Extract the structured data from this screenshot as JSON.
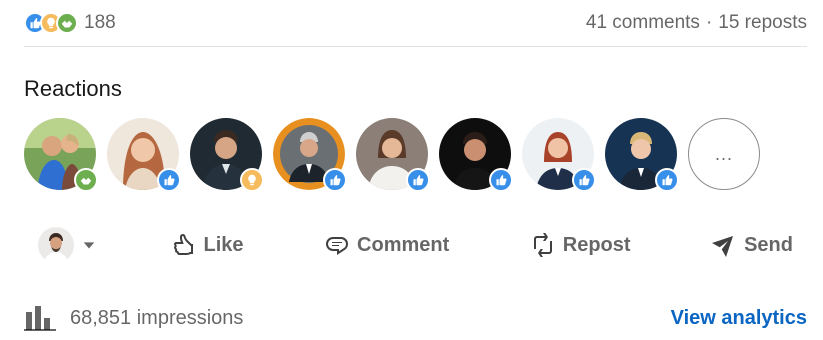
{
  "social": {
    "reaction_count": "188",
    "comments": "41 comments",
    "separator": "·",
    "reposts": "15 reposts",
    "reaction_icons": [
      "like-icon",
      "insightful-icon",
      "support-icon"
    ]
  },
  "reactions": {
    "title": "Reactions",
    "more_label": "..."
  },
  "actions": {
    "like": "Like",
    "comment": "Comment",
    "repost": "Repost",
    "send": "Send"
  },
  "impressions": {
    "text": "68,851 impressions",
    "analytics_link": "View analytics"
  },
  "colors": {
    "like": "#378fe9",
    "insightful": "#f5bb5c",
    "support": "#6dae4f",
    "link": "#0a66c2"
  }
}
